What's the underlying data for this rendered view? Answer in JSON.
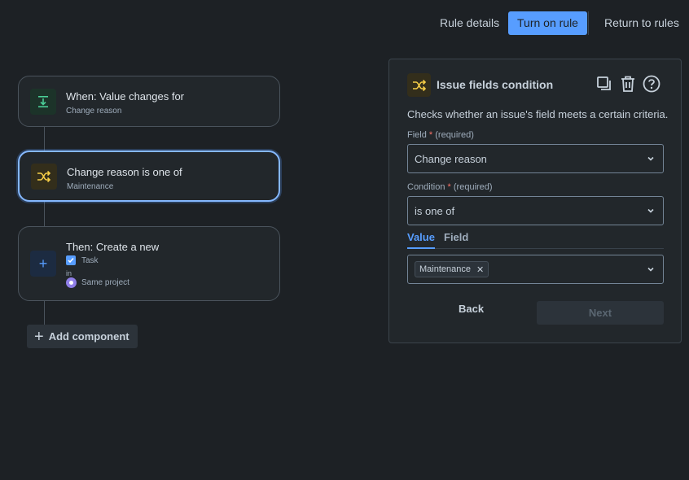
{
  "topbar": {
    "rule_details_label": "Rule details",
    "turn_on_label": "Turn on rule",
    "return_label": "Return to rules"
  },
  "flow": {
    "trigger": {
      "title": "When: Value changes for",
      "subtitle": "Change reason",
      "icon": "field-change-icon"
    },
    "condition": {
      "title": "Change reason is one of",
      "subtitle": "Maintenance",
      "icon": "shuffle-icon"
    },
    "action": {
      "title": "Then: Create a new",
      "issue_type": "Task",
      "in_label": "in",
      "project": "Same project",
      "icon": "plus-icon"
    },
    "add_component_label": "Add component"
  },
  "panel": {
    "title": "Issue fields condition",
    "description": "Checks whether an issue's field meets a certain criteria.",
    "field_label": "Field",
    "field_required_hint": "(required)",
    "field_value": "Change reason",
    "condition_label": "Condition",
    "condition_required_hint": "(required)",
    "condition_value": "is one of",
    "tabs": [
      "Value",
      "Field"
    ],
    "value_chips": [
      "Maintenance"
    ],
    "back_label": "Back",
    "next_label": "Next"
  },
  "colors": {
    "accent": "#579dff",
    "background": "#1d2125",
    "card": "#22272b",
    "condition_icon": "#f5cd47",
    "trigger_icon": "#4bce97"
  }
}
